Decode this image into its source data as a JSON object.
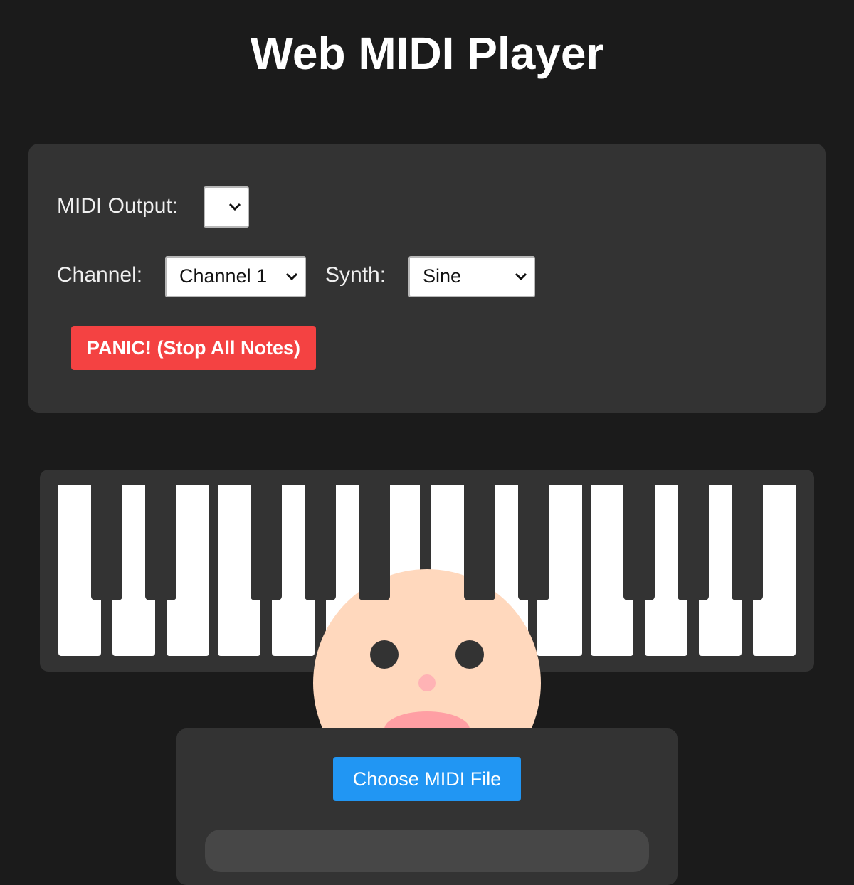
{
  "title": "Web MIDI Player",
  "controls": {
    "midi_output_label": "MIDI Output:",
    "midi_output_value": "",
    "channel_label": "Channel:",
    "channel_value": "Channel 1",
    "synth_label": "Synth:",
    "synth_value": "Sine",
    "panic_label": "PANIC! (Stop All Notes)"
  },
  "keyboard": {
    "white_keys": 14,
    "black_keys": 10
  },
  "file": {
    "choose_label": "Choose MIDI File"
  },
  "colors": {
    "background": "#1b1b1b",
    "panel": "#333333",
    "panic": "#f44242",
    "accent": "#2196f3",
    "white_key": "#ffffff",
    "black_key": "#333333",
    "mascot_skin": "#ffd8bd",
    "mascot_mouth": "#ff9fa4"
  }
}
